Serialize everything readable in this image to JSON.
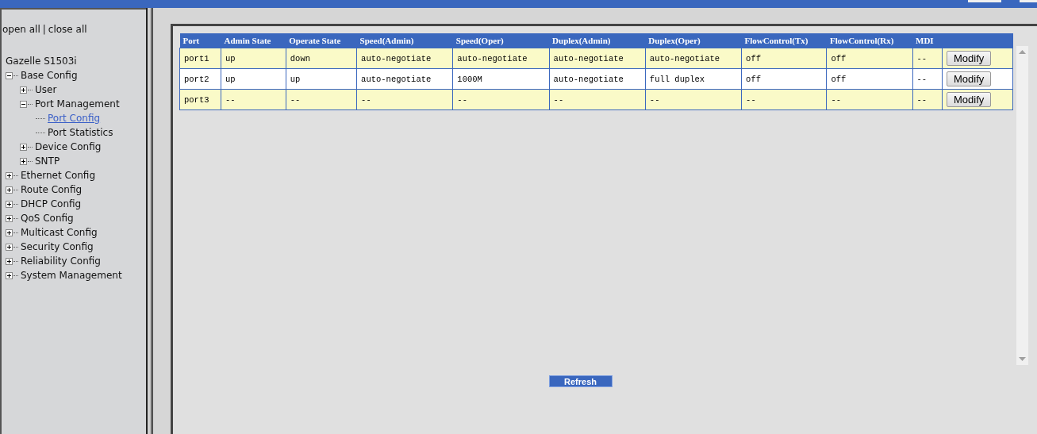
{
  "tree_links": [
    {
      "label": "open all"
    },
    {
      "label": "close all"
    }
  ],
  "tree_links_separator": "|",
  "tree": {
    "label": "Gazelle S1503i",
    "children": [
      {
        "label": "Base Config",
        "expanded": true,
        "children": [
          {
            "label": "User",
            "expanded": false
          },
          {
            "label": "Port Management",
            "expanded": true,
            "children": [
              {
                "label": "Port Config",
                "selected": true
              },
              {
                "label": "Port Statistics",
                "selected": false
              }
            ]
          },
          {
            "label": "Device Config",
            "expanded": false
          },
          {
            "label": "SNTP",
            "expanded": false
          }
        ]
      },
      {
        "label": "Ethernet Config",
        "expanded": false
      },
      {
        "label": "Route Config",
        "expanded": false
      },
      {
        "label": "DHCP Config",
        "expanded": false
      },
      {
        "label": "QoS Config",
        "expanded": false
      },
      {
        "label": "Multicast Config",
        "expanded": false
      },
      {
        "label": "Security Config",
        "expanded": false
      },
      {
        "label": "Reliability Config",
        "expanded": false
      },
      {
        "label": "System Management",
        "expanded": false
      }
    ]
  },
  "table": {
    "columns": [
      "Port",
      "Admin State",
      "Operate State",
      "Speed(Admin)",
      "Speed(Oper)",
      "Duplex(Admin)",
      "Duplex(Oper)",
      "FlowControl(Tx)",
      "FlowControl(Rx)",
      "MDI"
    ],
    "rows": [
      {
        "cells": [
          "port1",
          "up",
          "down",
          "auto-negotiate",
          "auto-negotiate",
          "auto-negotiate",
          "auto-negotiate",
          "off",
          "off",
          "--"
        ],
        "button": "Modify"
      },
      {
        "cells": [
          "port2",
          "up",
          "up",
          "auto-negotiate",
          "1000M",
          "auto-negotiate",
          "full duplex",
          "off",
          "off",
          "--"
        ],
        "button": "Modify"
      },
      {
        "cells": [
          "port3",
          "--",
          "--",
          "--",
          "--",
          "--",
          "--",
          "--",
          "--",
          "--"
        ],
        "button": "Modify"
      }
    ]
  },
  "refresh_button": "Refresh"
}
